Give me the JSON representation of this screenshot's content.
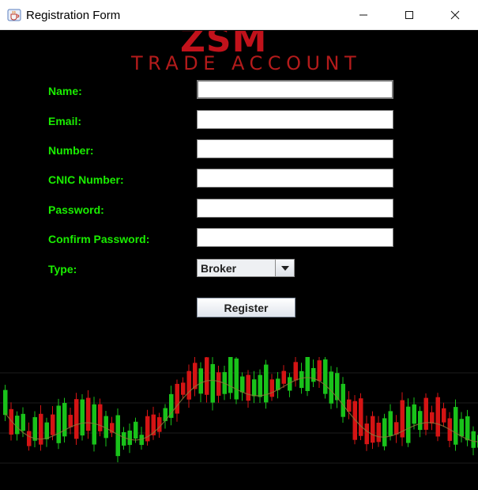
{
  "window": {
    "title": "Registration Form",
    "icons": {
      "app": "java-cup-icon",
      "minimize": "minimize-icon",
      "maximize": "maximize-icon",
      "close": "close-icon"
    }
  },
  "logo": {
    "main": "ZSM",
    "subtitle": "TRADE ACCOUNT",
    "color": "#c1121b"
  },
  "form": {
    "label_color": "#1aee00",
    "fields": {
      "name": {
        "label": "Name:",
        "value": ""
      },
      "email": {
        "label": "Email:",
        "value": ""
      },
      "number": {
        "label": "Number:",
        "value": ""
      },
      "cnic": {
        "label": "CNIC Number:",
        "value": ""
      },
      "password": {
        "label": "Password:",
        "value": ""
      },
      "confirm_password": {
        "label": "Confirm Password:",
        "value": ""
      }
    },
    "type": {
      "label": "Type:",
      "selected": "Broker"
    },
    "register_label": "Register"
  },
  "background": {
    "image": "candlestick-chart-image",
    "bull_color": "#19c21a",
    "bear_color": "#d41414"
  }
}
